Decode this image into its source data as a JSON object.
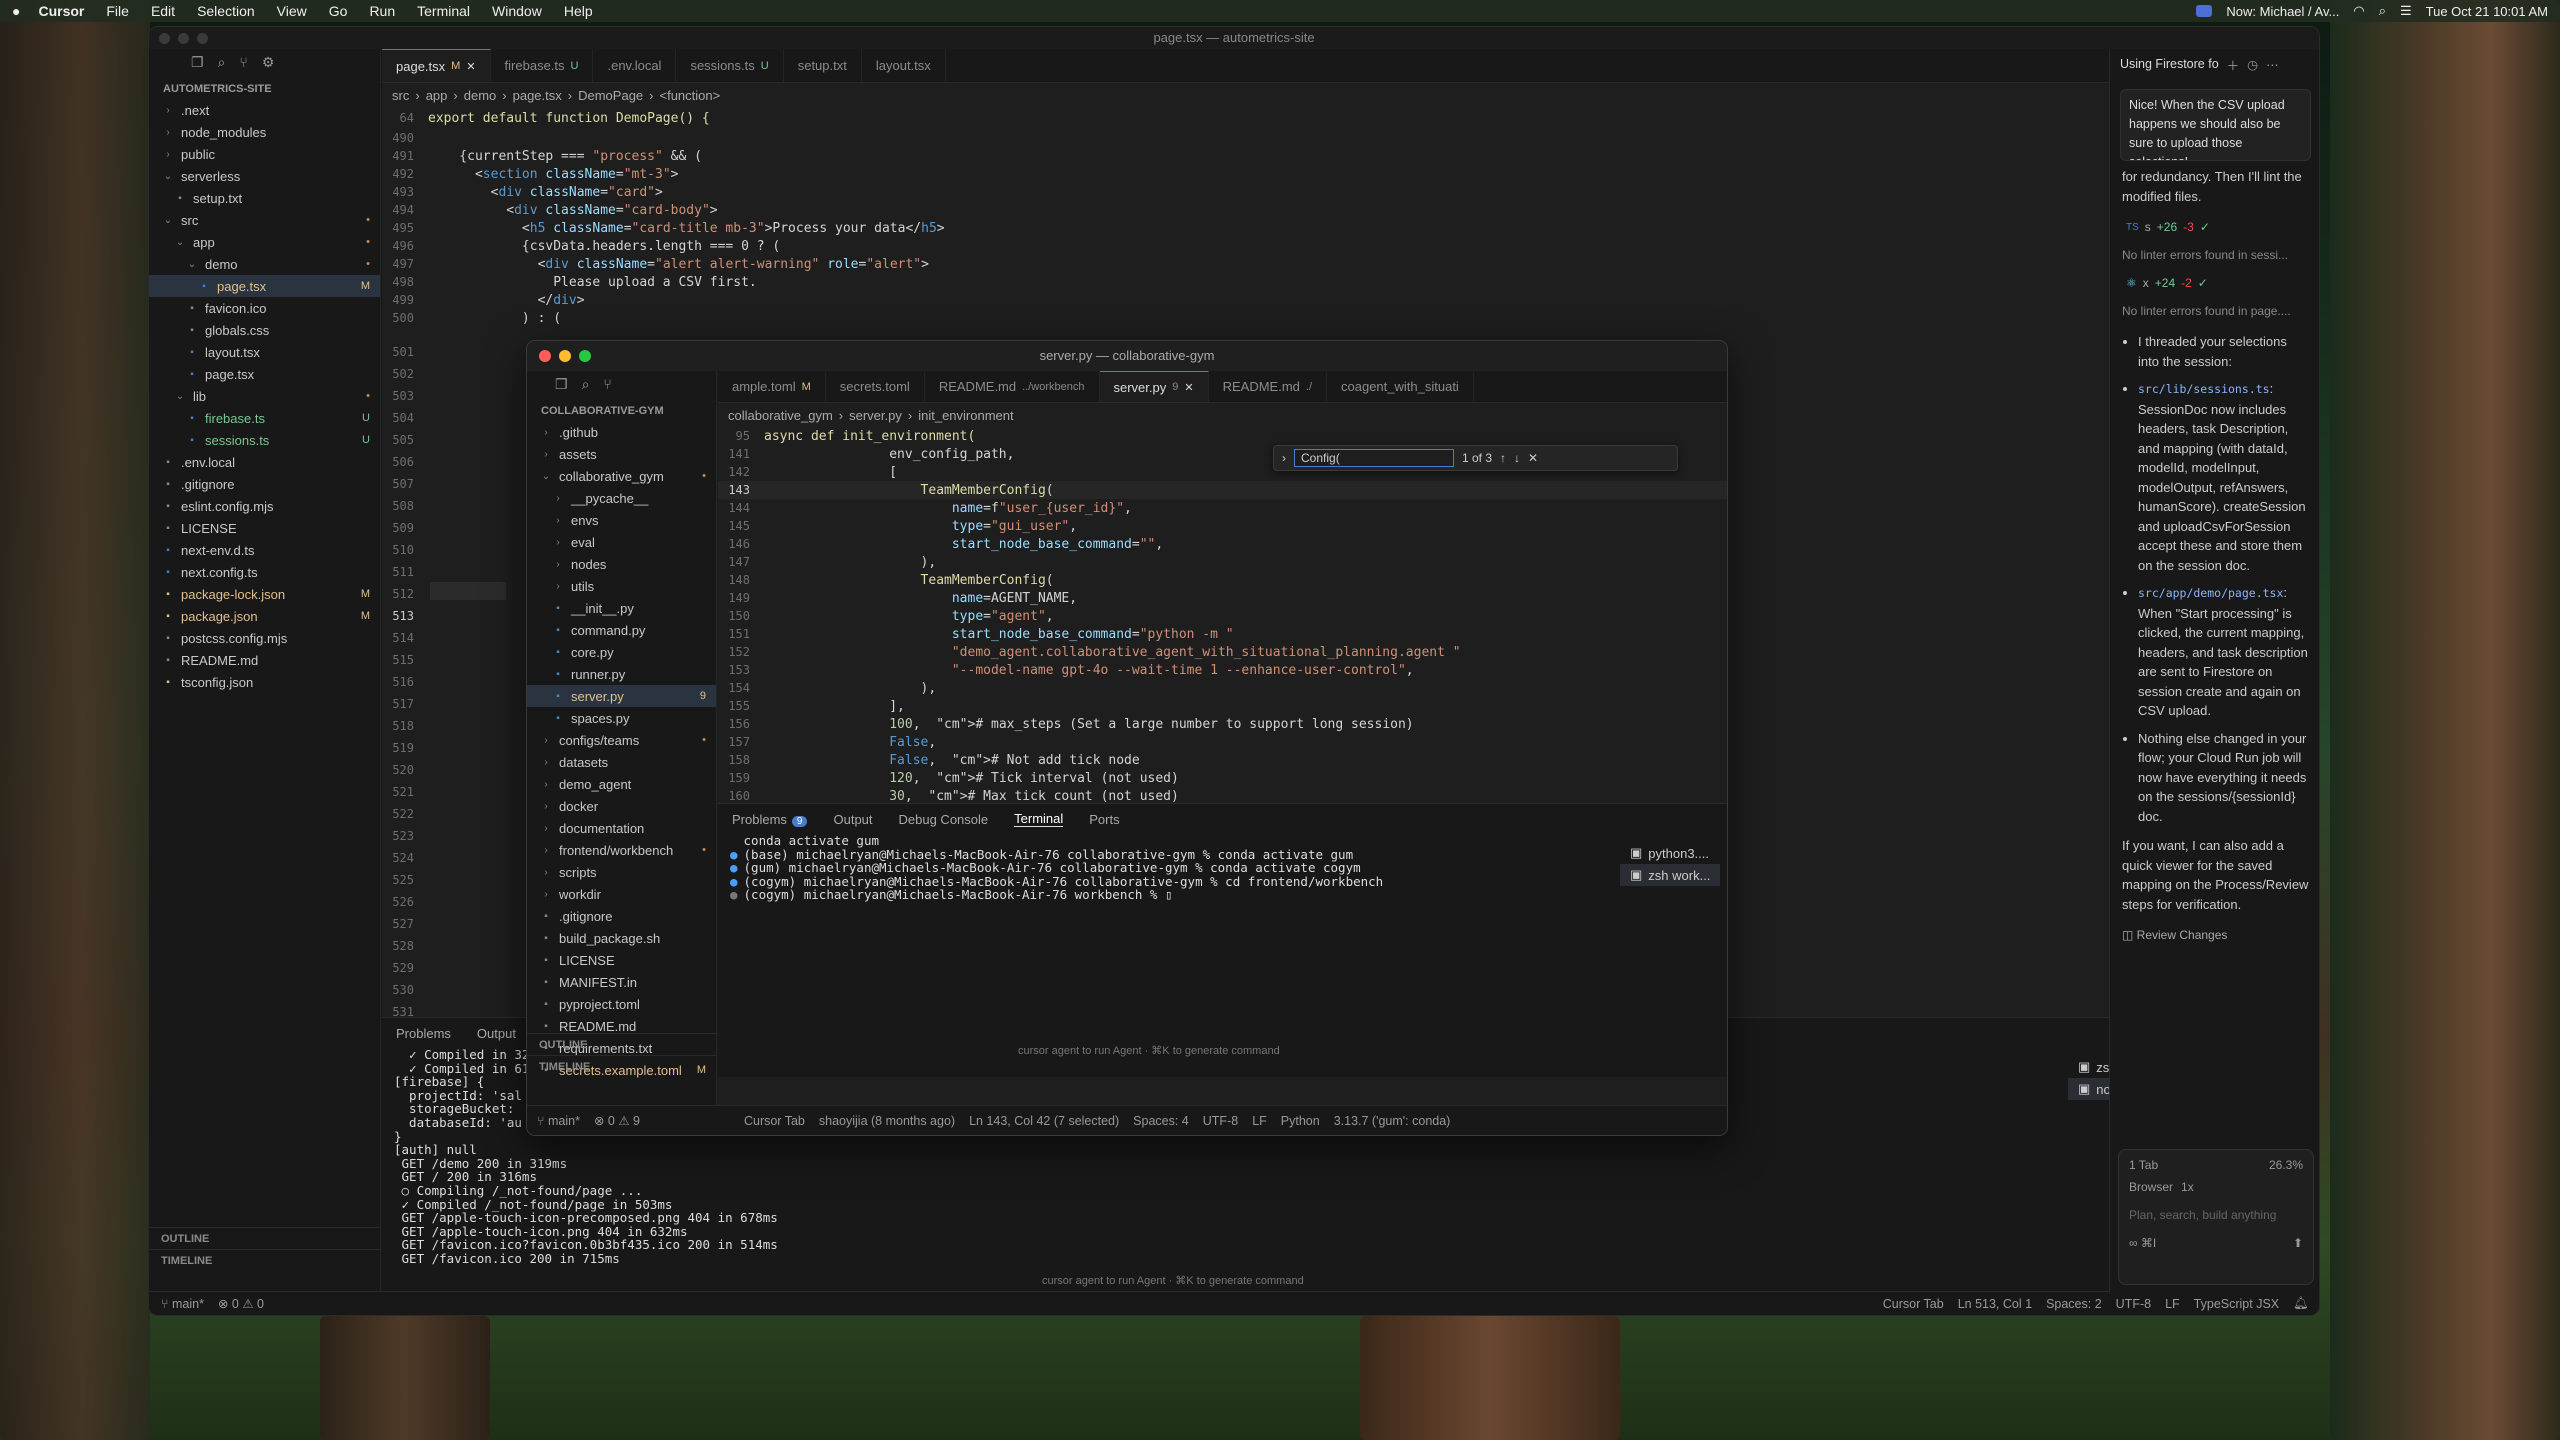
{
  "menubar": {
    "app": "Cursor",
    "items": [
      "File",
      "Edit",
      "Selection",
      "View",
      "Go",
      "Run",
      "Terminal",
      "Window",
      "Help"
    ],
    "now_playing": "Now: Michael / Av...",
    "datetime": "Tue Oct 21  10:01 AM"
  },
  "main": {
    "title": "page.tsx — autometrics-site",
    "tabs": [
      {
        "label": "page.tsx",
        "badge": "M",
        "active": true
      },
      {
        "label": "firebase.ts",
        "badge": "U"
      },
      {
        "label": ".env.local",
        "badge": ""
      },
      {
        "label": "sessions.ts",
        "badge": "U"
      },
      {
        "label": "setup.txt",
        "badge": ""
      },
      {
        "label": "layout.tsx",
        "badge": ""
      }
    ],
    "explorer_title": "AUTOMETRICS-SITE",
    "tree": [
      {
        "label": ".next",
        "depth": 0,
        "kind": "folder",
        "open": false,
        "status": ""
      },
      {
        "label": "node_modules",
        "depth": 0,
        "kind": "folder",
        "open": false,
        "status": ""
      },
      {
        "label": "public",
        "depth": 0,
        "kind": "folder",
        "open": false,
        "status": ""
      },
      {
        "label": "serverless",
        "depth": 0,
        "kind": "folder",
        "open": true,
        "status": ""
      },
      {
        "label": "setup.txt",
        "depth": 1,
        "kind": "file",
        "status": ""
      },
      {
        "label": "src",
        "depth": 0,
        "kind": "folder",
        "open": true,
        "status": "•"
      },
      {
        "label": "app",
        "depth": 1,
        "kind": "folder",
        "open": true,
        "status": "•"
      },
      {
        "label": "demo",
        "depth": 2,
        "kind": "folder",
        "open": true,
        "status": "•"
      },
      {
        "label": "page.tsx",
        "depth": 3,
        "kind": "file",
        "status": "M",
        "selected": true
      },
      {
        "label": "favicon.ico",
        "depth": 2,
        "kind": "file",
        "status": ""
      },
      {
        "label": "globals.css",
        "depth": 2,
        "kind": "file",
        "status": ""
      },
      {
        "label": "layout.tsx",
        "depth": 2,
        "kind": "file",
        "status": ""
      },
      {
        "label": "page.tsx",
        "depth": 2,
        "kind": "file",
        "status": ""
      },
      {
        "label": "lib",
        "depth": 1,
        "kind": "folder",
        "open": true,
        "status": "•"
      },
      {
        "label": "firebase.ts",
        "depth": 2,
        "kind": "file",
        "status": "U"
      },
      {
        "label": "sessions.ts",
        "depth": 2,
        "kind": "file",
        "status": "U"
      },
      {
        "label": ".env.local",
        "depth": 0,
        "kind": "file",
        "status": ""
      },
      {
        "label": ".gitignore",
        "depth": 0,
        "kind": "file",
        "status": ""
      },
      {
        "label": "eslint.config.mjs",
        "depth": 0,
        "kind": "file",
        "status": ""
      },
      {
        "label": "LICENSE",
        "depth": 0,
        "kind": "file",
        "status": ""
      },
      {
        "label": "next-env.d.ts",
        "depth": 0,
        "kind": "file",
        "status": ""
      },
      {
        "label": "next.config.ts",
        "depth": 0,
        "kind": "file",
        "status": ""
      },
      {
        "label": "package-lock.json",
        "depth": 0,
        "kind": "file",
        "status": "M"
      },
      {
        "label": "package.json",
        "depth": 0,
        "kind": "file",
        "status": "M"
      },
      {
        "label": "postcss.config.mjs",
        "depth": 0,
        "kind": "file",
        "status": ""
      },
      {
        "label": "README.md",
        "depth": 0,
        "kind": "file",
        "status": ""
      },
      {
        "label": "tsconfig.json",
        "depth": 0,
        "kind": "file",
        "status": ""
      }
    ],
    "outline": "OUTLINE",
    "timeline": "TIMELINE",
    "breadcrumb": [
      "src",
      "app",
      "demo",
      "page.tsx",
      "DemoPage",
      "<function>"
    ],
    "sticky_line": {
      "num": "64",
      "text": "export default function DemoPage() {"
    },
    "code": [
      {
        "n": "490",
        "t": ""
      },
      {
        "n": "491",
        "t": "    {currentStep === \"process\" && ("
      },
      {
        "n": "492",
        "t": "      <section className=\"mt-3\">"
      },
      {
        "n": "493",
        "t": "        <div className=\"card\">"
      },
      {
        "n": "494",
        "t": "          <div className=\"card-body\">"
      },
      {
        "n": "495",
        "t": "            <h5 className=\"card-title mb-3\">Process your data</h5>"
      },
      {
        "n": "496",
        "t": "            {csvData.headers.length === 0 ? ("
      },
      {
        "n": "497",
        "t": "              <div className=\"alert alert-warning\" role=\"alert\">"
      },
      {
        "n": "498",
        "t": "                Please upload a CSV first."
      },
      {
        "n": "499",
        "t": "              </div>"
      },
      {
        "n": "500",
        "t": "            ) : ("
      }
    ],
    "gutter_more": [
      "501",
      "502",
      "503",
      "504",
      "505",
      "506",
      "507",
      "508",
      "509",
      "510",
      "511",
      "512",
      "513",
      "514",
      "515",
      "516",
      "517",
      "518",
      "519",
      "520",
      "521",
      "522",
      "523",
      "524",
      "525",
      "526",
      "527",
      "528",
      "529",
      "530",
      "531",
      "532",
      "533",
      "534",
      "535",
      "536"
    ],
    "panel_tabs": [
      "Problems",
      "Output"
    ],
    "terminal": [
      "  ✓ Compiled in 32",
      "  ✓ Compiled in 61",
      "[firebase] {",
      "  projectId: 'sal",
      "  storageBucket:",
      "  databaseId: 'au",
      "}",
      "[auth] null",
      " GET /demo 200 in 319ms",
      " GET / 200 in 316ms",
      " ○ Compiling /_not-found/page ...",
      " ✓ Compiled /_not-found/page in 503ms",
      " GET /apple-touch-icon-precomposed.png 404 in 678ms",
      " GET /apple-touch-icon.png 404 in 632ms",
      " GET /favicon.ico?favicon.0b3bf435.ico 200 in 514ms",
      " GET /favicon.ico 200 in 715ms"
    ],
    "terminal_list": [
      "zsh",
      "node"
    ],
    "agent_hint": "cursor agent to run Agent · ⌘K to generate command",
    "status": {
      "branch": "main*",
      "errors": "0",
      "warnings": "0",
      "cursor_tab": "Cursor Tab",
      "position": "Ln 513, Col 1",
      "spaces": "Spaces: 2",
      "encoding": "UTF-8",
      "eol": "LF",
      "language": "TypeScript JSX"
    }
  },
  "float": {
    "title": "server.py — collaborative-gym",
    "tabs": [
      {
        "label": "ample.toml",
        "badge": "M"
      },
      {
        "label": "secrets.toml",
        "badge": ""
      },
      {
        "label": "README.md",
        "badge": "../workbench"
      },
      {
        "label": "server.py",
        "badge": "9",
        "active": true
      },
      {
        "label": "README.md",
        "badge": "./"
      },
      {
        "label": "coagent_with_situati",
        "badge": ""
      }
    ],
    "explorer_title": "COLLABORATIVE-GYM",
    "tree": [
      {
        "label": ".github",
        "depth": 0,
        "kind": "folder"
      },
      {
        "label": "assets",
        "depth": 0,
        "kind": "folder"
      },
      {
        "label": "collaborative_gym",
        "depth": 0,
        "kind": "folder",
        "open": true,
        "status": "•"
      },
      {
        "label": "__pycache__",
        "depth": 1,
        "kind": "folder"
      },
      {
        "label": "envs",
        "depth": 1,
        "kind": "folder"
      },
      {
        "label": "eval",
        "depth": 1,
        "kind": "folder"
      },
      {
        "label": "nodes",
        "depth": 1,
        "kind": "folder"
      },
      {
        "label": "utils",
        "depth": 1,
        "kind": "folder"
      },
      {
        "label": "__init__.py",
        "depth": 1,
        "kind": "file"
      },
      {
        "label": "command.py",
        "depth": 1,
        "kind": "file"
      },
      {
        "label": "core.py",
        "depth": 1,
        "kind": "file"
      },
      {
        "label": "runner.py",
        "depth": 1,
        "kind": "file"
      },
      {
        "label": "server.py",
        "depth": 1,
        "kind": "file",
        "status": "9",
        "selected": true
      },
      {
        "label": "spaces.py",
        "depth": 1,
        "kind": "file"
      },
      {
        "label": "configs/teams",
        "depth": 0,
        "kind": "folder",
        "status": "•"
      },
      {
        "label": "datasets",
        "depth": 0,
        "kind": "folder"
      },
      {
        "label": "demo_agent",
        "depth": 0,
        "kind": "folder"
      },
      {
        "label": "docker",
        "depth": 0,
        "kind": "folder"
      },
      {
        "label": "documentation",
        "depth": 0,
        "kind": "folder"
      },
      {
        "label": "frontend/workbench",
        "depth": 0,
        "kind": "folder",
        "status": "•"
      },
      {
        "label": "scripts",
        "depth": 0,
        "kind": "folder"
      },
      {
        "label": "workdir",
        "depth": 0,
        "kind": "folder"
      },
      {
        "label": ".gitignore",
        "depth": 0,
        "kind": "file"
      },
      {
        "label": "build_package.sh",
        "depth": 0,
        "kind": "file"
      },
      {
        "label": "LICENSE",
        "depth": 0,
        "kind": "file"
      },
      {
        "label": "MANIFEST.in",
        "depth": 0,
        "kind": "file"
      },
      {
        "label": "pyproject.toml",
        "depth": 0,
        "kind": "file"
      },
      {
        "label": "README.md",
        "depth": 0,
        "kind": "file"
      },
      {
        "label": "requirements.txt",
        "depth": 0,
        "kind": "file"
      },
      {
        "label": "secrets.example.toml",
        "depth": 0,
        "kind": "file",
        "status": "M"
      }
    ],
    "outline": "OUTLINE",
    "timeline": "TIMELINE",
    "breadcrumb": [
      "collaborative_gym",
      "server.py",
      "init_environment"
    ],
    "sticky": {
      "num": "95",
      "text": "async def init_environment("
    },
    "find": {
      "value": "Config(",
      "count": "1 of 3"
    },
    "code": [
      {
        "n": "141",
        "t": "                env_config_path,"
      },
      {
        "n": "142",
        "t": "                ["
      },
      {
        "n": "143",
        "t": "                    TeamMemberConfig("
      },
      {
        "n": "144",
        "t": "                        name=f\"user_{user_id}\","
      },
      {
        "n": "145",
        "t": "                        type=\"gui_user\","
      },
      {
        "n": "146",
        "t": "                        start_node_base_command=\"\","
      },
      {
        "n": "147",
        "t": "                    ),"
      },
      {
        "n": "148",
        "t": "                    TeamMemberConfig("
      },
      {
        "n": "149",
        "t": "                        name=AGENT_NAME,"
      },
      {
        "n": "150",
        "t": "                        type=\"agent\","
      },
      {
        "n": "151",
        "t": "                        start_node_base_command=\"python -m \""
      },
      {
        "n": "152",
        "t": "                        \"demo_agent.collaborative_agent_with_situational_planning.agent \""
      },
      {
        "n": "153",
        "t": "                        \"--model-name gpt-4o --wait-time 1 --enhance-user-control\","
      },
      {
        "n": "154",
        "t": "                    ),"
      },
      {
        "n": "155",
        "t": "                ],"
      },
      {
        "n": "156",
        "t": "                100,  # max_steps (Set a large number to support long session)"
      },
      {
        "n": "157",
        "t": "                False,"
      },
      {
        "n": "158",
        "t": "                False,  # Not add tick node"
      },
      {
        "n": "159",
        "t": "                120,  # Tick interval (not used)"
      },
      {
        "n": "160",
        "t": "                30,  # Max tick count (not used)"
      }
    ],
    "panel_tabs": [
      {
        "label": "Problems",
        "badge": "9"
      },
      {
        "label": "Output"
      },
      {
        "label": "Debug Console"
      },
      {
        "label": "Terminal",
        "active": true
      },
      {
        "label": "Ports"
      }
    ],
    "terminal": [
      {
        "dot": "",
        "t": "conda activate gum"
      },
      {
        "dot": "blue",
        "t": "(base) michaelryan@Michaels-MacBook-Air-76 collaborative-gym % conda activate gum"
      },
      {
        "dot": "blue",
        "t": "(gum) michaelryan@Michaels-MacBook-Air-76 collaborative-gym % conda activate cogym"
      },
      {
        "dot": "blue",
        "t": "(cogym) michaelryan@Michaels-MacBook-Air-76 collaborative-gym % cd frontend/workbench"
      },
      {
        "dot": "grey",
        "t": "(cogym) michaelryan@Michaels-MacBook-Air-76 workbench % ▯"
      }
    ],
    "terminal_list": [
      "python3....",
      "zsh work..."
    ],
    "agent_hint": "cursor agent to run Agent · ⌘K to generate command",
    "status": {
      "branch": "main*",
      "errors": "0",
      "warnings": "9",
      "cursor_tab": "Cursor Tab",
      "blame": "shaoyijia (8 months ago)",
      "position": "Ln 143, Col 42 (7 selected)",
      "spaces": "Spaces: 4",
      "encoding": "UTF-8",
      "eol": "LF",
      "language": "Python",
      "interpreter": "3.13.7 ('gum': conda)"
    }
  },
  "chat": {
    "title": "Using Firestore fo",
    "user_msg": "Nice!  When the CSV upload happens we should also be sure to upload those selections!",
    "p1": "for redundancy. Then I'll lint the modified files.",
    "edit1": {
      "file": "s",
      "add": "+26",
      "del": "-3"
    },
    "lint1": "No linter errors found in sessi...",
    "edit2": {
      "file": "x",
      "add": "+24",
      "del": "-2"
    },
    "lint2": "No linter errors found in page....",
    "bullets": [
      {
        "text": "I threaded your selections into the session:"
      },
      {
        "code": "src/lib/sessions.ts",
        "rest": ": SessionDoc now includes headers, task Description, and mapping (with dataId, modelId, modelInput, modelOutput, refAnswers, humanScore). createSession and uploadCsvForSession accept these and store them on the session doc."
      },
      {
        "code": "src/app/demo/page.tsx",
        "rest": ": When \"Start processing\" is clicked, the current mapping, headers, and task description are sent to Firestore on session create and again on CSV upload."
      },
      {
        "text": "Nothing else changed in your flow; your Cloud Run job will now have everything it needs on the sessions/{sessionId} doc."
      }
    ],
    "closing": "If you want, I can also add a quick viewer for the saved mapping on the Process/Review steps for verification.",
    "review": "Review Changes",
    "tab_count": "1 Tab",
    "percent": "26.3%",
    "browser": "Browser",
    "mode": "1x",
    "input_placeholder": "Plan, search, build anything",
    "model": "∞ ⌘I"
  },
  "colors": {
    "accent": "#4a7bd1",
    "modified": "#e2c08d",
    "untracked": "#73c991"
  }
}
